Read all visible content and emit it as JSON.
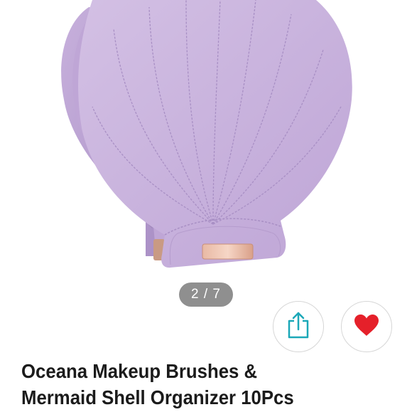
{
  "colors": {
    "shell": "#c9b3dd",
    "shell_dark": "#b79dcf",
    "pager_bg": "#8f8f8f",
    "share_accent": "#1ba8b8",
    "heart": "#e5202a",
    "title_text": "#1b1b1b"
  },
  "gallery": {
    "pager_text": "2 / 7",
    "image_subject": "purple-seashell-makeup-brush-organizer"
  },
  "actions": {
    "share_icon": "share-icon",
    "like_icon": "heart-icon"
  },
  "product": {
    "title_line1": "Oceana Makeup Brushes &",
    "title_line2": "Mermaid Shell Organizer 10Pcs"
  }
}
